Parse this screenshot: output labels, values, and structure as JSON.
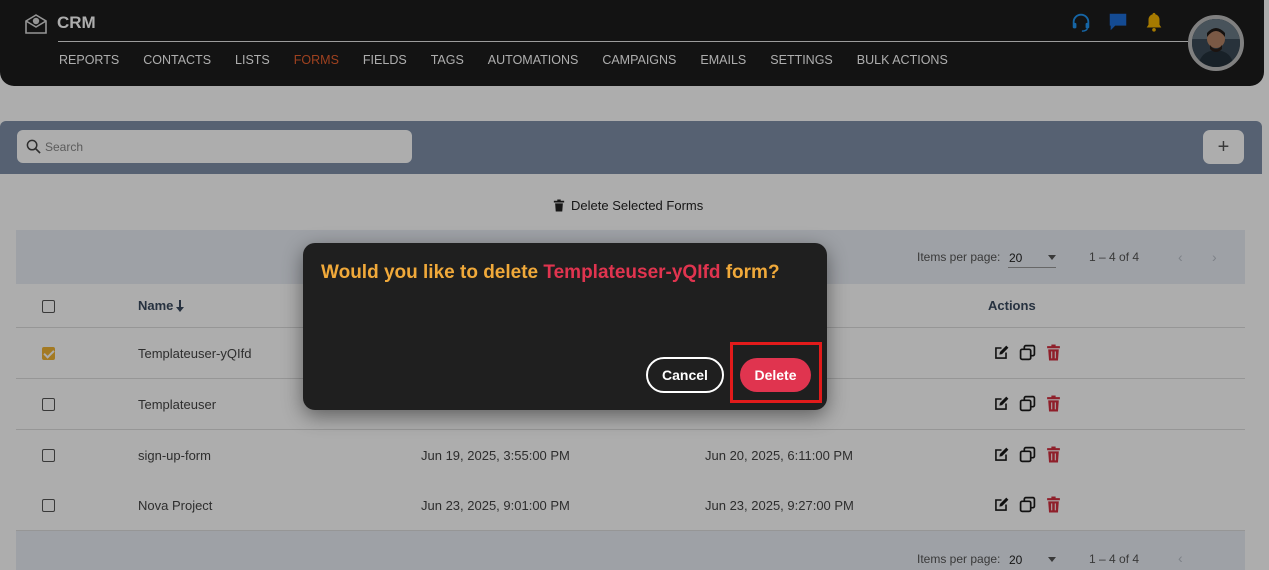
{
  "app": {
    "title": "CRM"
  },
  "nav": {
    "items": [
      "REPORTS",
      "CONTACTS",
      "LISTS",
      "FORMS",
      "FIELDS",
      "TAGS",
      "AUTOMATIONS",
      "CAMPAIGNS",
      "EMAILS",
      "SETTINGS",
      "BULK ACTIONS"
    ],
    "active": "FORMS"
  },
  "header_icons": [
    "headset-icon",
    "chat-icon",
    "bell-icon"
  ],
  "search": {
    "placeholder": "Search"
  },
  "toolbar": {
    "add_label": "+",
    "delete_selected_label": "Delete Selected Forms"
  },
  "pagination": {
    "items_per_page_label": "Items per page:",
    "items_per_page": "20",
    "range": "1 – 4 of 4"
  },
  "table": {
    "columns": {
      "name": "Name",
      "actions": "Actions"
    },
    "rows": [
      {
        "name": "Templateuser-yQIfd",
        "created": "",
        "updated": "",
        "checked": true
      },
      {
        "name": "Templateuser",
        "created": "",
        "updated": "",
        "checked": false
      },
      {
        "name": "sign-up-form",
        "created": "Jun 19, 2025, 3:55:00 PM",
        "updated": "Jun 20, 2025, 6:11:00 PM",
        "checked": false
      },
      {
        "name": "Nova Project",
        "created": "Jun 23, 2025, 9:01:00 PM",
        "updated": "Jun 23, 2025, 9:27:00 PM",
        "checked": false
      }
    ]
  },
  "dialog": {
    "message_prefix": "Would you like to delete ",
    "form_name": "Templateuser-yQIfd",
    "message_suffix": " form?",
    "cancel_label": "Cancel",
    "delete_label": "Delete"
  },
  "colors": {
    "header_bg": "#1c1c1c",
    "nav_active": "#e9602f",
    "toolbar_bg": "#7f90a8",
    "dialog_bg": "#1f1f1f",
    "dialog_text": "#f0a93a",
    "danger": "#e0344f",
    "checkbox_checked": "#f1b434"
  }
}
